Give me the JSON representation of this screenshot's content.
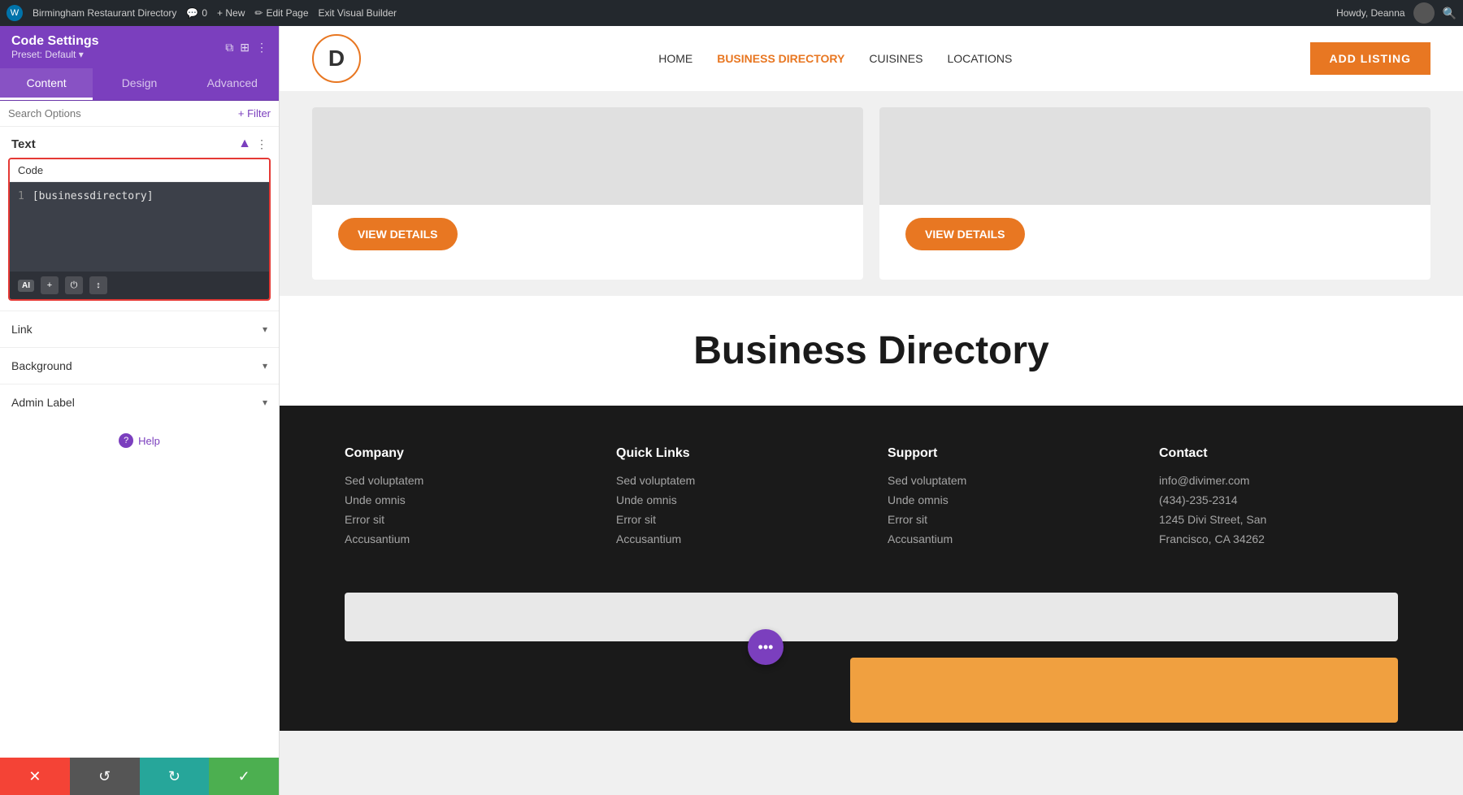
{
  "admin_bar": {
    "wp_icon": "W",
    "site_name": "Birmingham Restaurant Directory",
    "comments": "0",
    "new_label": "+ New",
    "edit_page": "Edit Page",
    "exit_builder": "Exit Visual Builder",
    "howdy": "Howdy, Deanna"
  },
  "panel": {
    "title": "Code Settings",
    "preset": "Preset: Default ▾",
    "tabs": [
      {
        "label": "Content",
        "active": true
      },
      {
        "label": "Design",
        "active": false
      },
      {
        "label": "Advanced",
        "active": false
      }
    ],
    "search_placeholder": "Search Options",
    "filter_label": "+ Filter",
    "sections": {
      "text": {
        "title": "Text",
        "code_label": "Code",
        "code_line_num": "1",
        "code_content": "[businessdirectory]",
        "ai_label": "AI",
        "toolbar_icons": [
          "+",
          "⏻",
          "↕"
        ]
      },
      "link": {
        "title": "Link"
      },
      "background": {
        "title": "Background"
      },
      "admin_label": {
        "title": "Admin Label"
      }
    },
    "help_label": "Help"
  },
  "bottom_bar": {
    "cancel_icon": "✕",
    "undo_icon": "↺",
    "redo_icon": "↻",
    "save_icon": "✓"
  },
  "site": {
    "logo_letter": "D",
    "nav": {
      "home": "HOME",
      "business_directory": "BUSINESS DIRECTORY",
      "cuisines": "CUISINES",
      "locations": "LOCATIONS"
    },
    "add_listing": "ADD LISTING"
  },
  "cards": [
    {
      "view_details": "VIEW DETAILS"
    },
    {
      "view_details": "VIEW DETAILS"
    }
  ],
  "directory": {
    "title": "Business Directory"
  },
  "footer": {
    "columns": [
      {
        "title": "Company",
        "links": [
          "Sed voluptatem",
          "Unde omnis",
          "Error sit",
          "Accusantium"
        ]
      },
      {
        "title": "Quick Links",
        "links": [
          "Sed voluptatem",
          "Unde omnis",
          "Error sit",
          "Accusantium"
        ]
      },
      {
        "title": "Support",
        "links": [
          "Sed voluptatem",
          "Unde omnis",
          "Error sit",
          "Accusantium"
        ]
      },
      {
        "title": "Contact",
        "links": [
          "info@divimer.com",
          "(434)-235-2314",
          "1245 Divi Street, San",
          "Francisco, CA 34262"
        ]
      }
    ]
  },
  "floating_btn": {
    "icon": "•••"
  }
}
